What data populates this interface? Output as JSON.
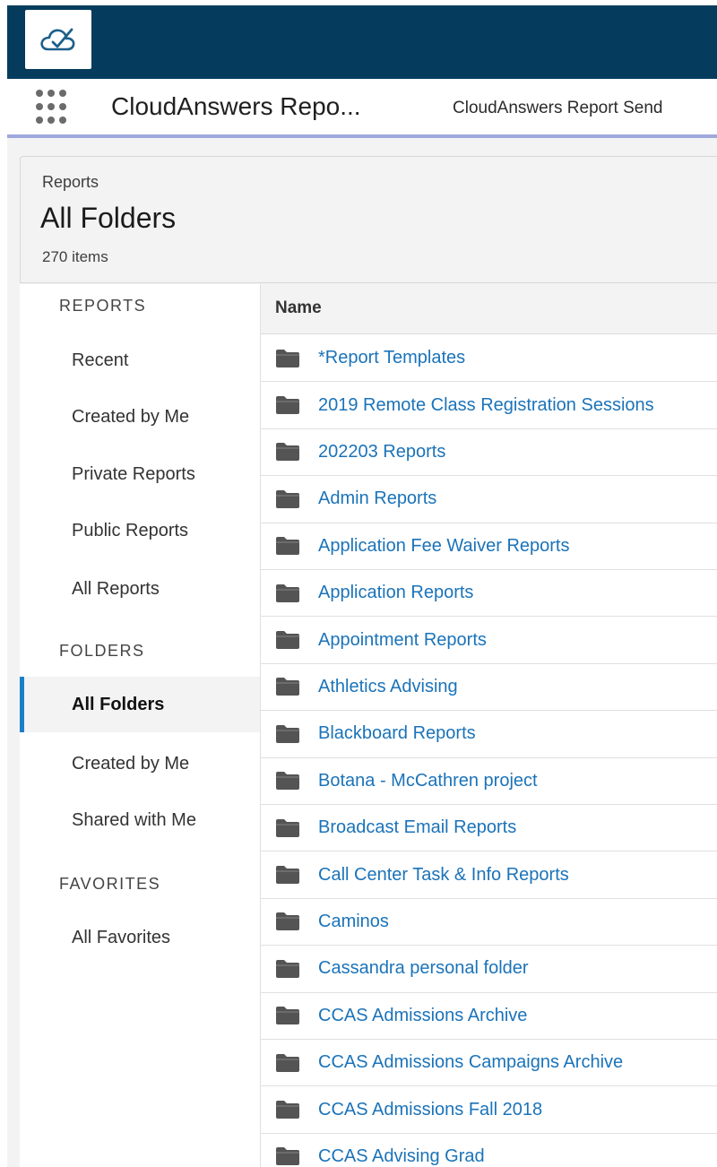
{
  "app": {
    "name": "CloudAnswers Repo...",
    "tab_label": "CloudAnswers Report Send"
  },
  "header": {
    "breadcrumb": "Reports",
    "title": "All Folders",
    "count": "270 items"
  },
  "sidebar": {
    "sections": [
      {
        "heading": "REPORTS",
        "items": [
          "Recent",
          "Created by Me",
          "Private Reports",
          "Public Reports",
          "All Reports"
        ]
      },
      {
        "heading": "FOLDERS",
        "items": [
          "All Folders",
          "Created by Me",
          "Shared with Me"
        ]
      },
      {
        "heading": "FAVORITES",
        "items": [
          "All Favorites"
        ]
      }
    ],
    "active": "All Folders"
  },
  "table": {
    "column_name": "Name",
    "rows": [
      "*Report Templates",
      "2019 Remote Class Registration Sessions",
      "202203 Reports",
      "Admin Reports",
      "Application Fee Waiver Reports",
      "Application Reports",
      "Appointment Reports",
      "Athletics Advising",
      "Blackboard Reports",
      "Botana - McCathren project",
      "Broadcast Email Reports",
      "Call Center Task & Info Reports",
      "Caminos",
      "Cassandra personal folder",
      "CCAS Admissions Archive",
      "CCAS Admissions Campaigns Archive",
      "CCAS Admissions Fall 2018",
      "CCAS Advising   Grad"
    ]
  },
  "icons": {
    "logo": "cloud-check-icon",
    "launcher": "app-launcher-icon",
    "folder": "folder-icon"
  },
  "colors": {
    "topbar": "#053c5e",
    "link": "#1b73b9",
    "active_accent": "#1b7fc8",
    "nav_underline": "#9fa8dc"
  }
}
